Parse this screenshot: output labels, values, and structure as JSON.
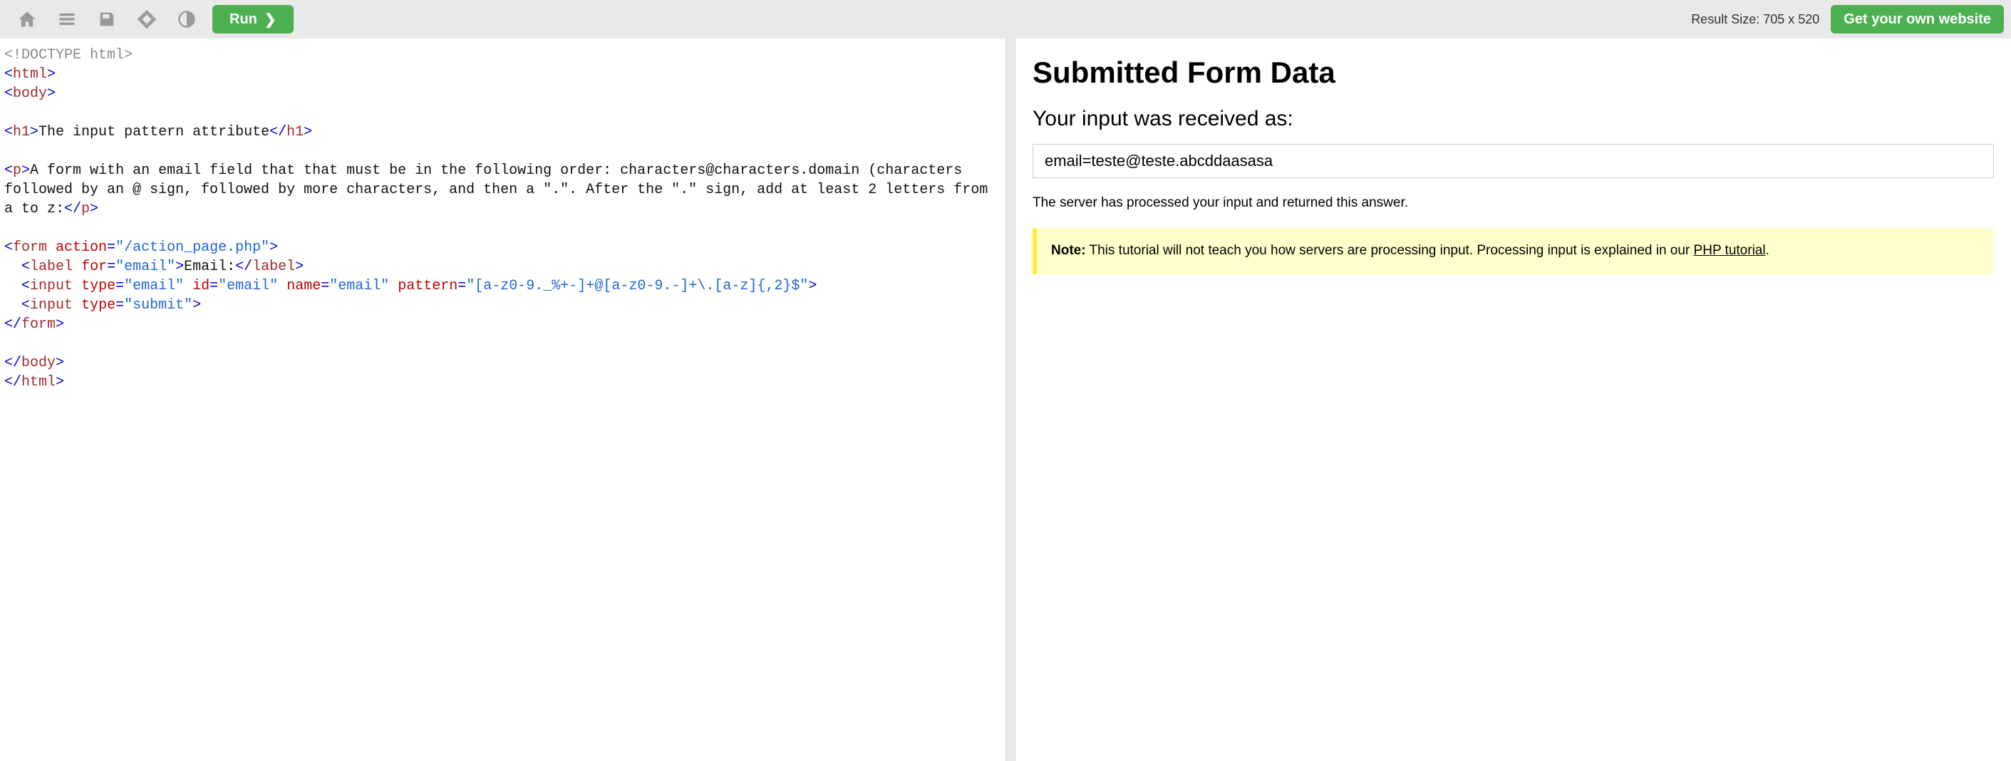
{
  "toolbar": {
    "run_label": "Run",
    "result_size": "Result Size: 705 x 520",
    "get_own_label": "Get your own website"
  },
  "code": {
    "doctype": "<!DOCTYPE html>",
    "html_open": "html",
    "body_open": "body",
    "h1_tag": "h1",
    "h1_text": "The input pattern attribute",
    "p_tag": "p",
    "p_text": "A form with an email field that that must be in the following order: characters@characters.domain (characters followed by an @ sign, followed by more characters, and then a \".\". After the \".\" sign, add at least 2 letters from a to z:",
    "form_tag": "form",
    "form_action_attr": "action",
    "form_action_val": "\"/action_page.php\"",
    "label_tag": "label",
    "label_for_attr": "for",
    "label_for_val": "\"email\"",
    "label_text": "Email:",
    "input_tag": "input",
    "type_attr": "type",
    "email_type_val": "\"email\"",
    "id_attr": "id",
    "id_val": "\"email\"",
    "name_attr": "name",
    "name_val": "\"email\"",
    "pattern_attr": "pattern",
    "pattern_val": "\"[a-z0-9._%+-]+@[a-z0-9.-]+\\.[a-z]{,2}$\"",
    "submit_type_val": "\"submit\"",
    "body_close": "body",
    "html_close": "html"
  },
  "result": {
    "heading": "Submitted Form Data",
    "subheading": "Your input was received as:",
    "received": "email=teste@teste.abcddaasasa",
    "processed": "The server has processed your input and returned this answer.",
    "note_label": "Note:",
    "note_text1": " This tutorial will not teach you how servers are processing input. Processing input is explained in our ",
    "note_link": "PHP tutorial",
    "note_text2": "."
  }
}
